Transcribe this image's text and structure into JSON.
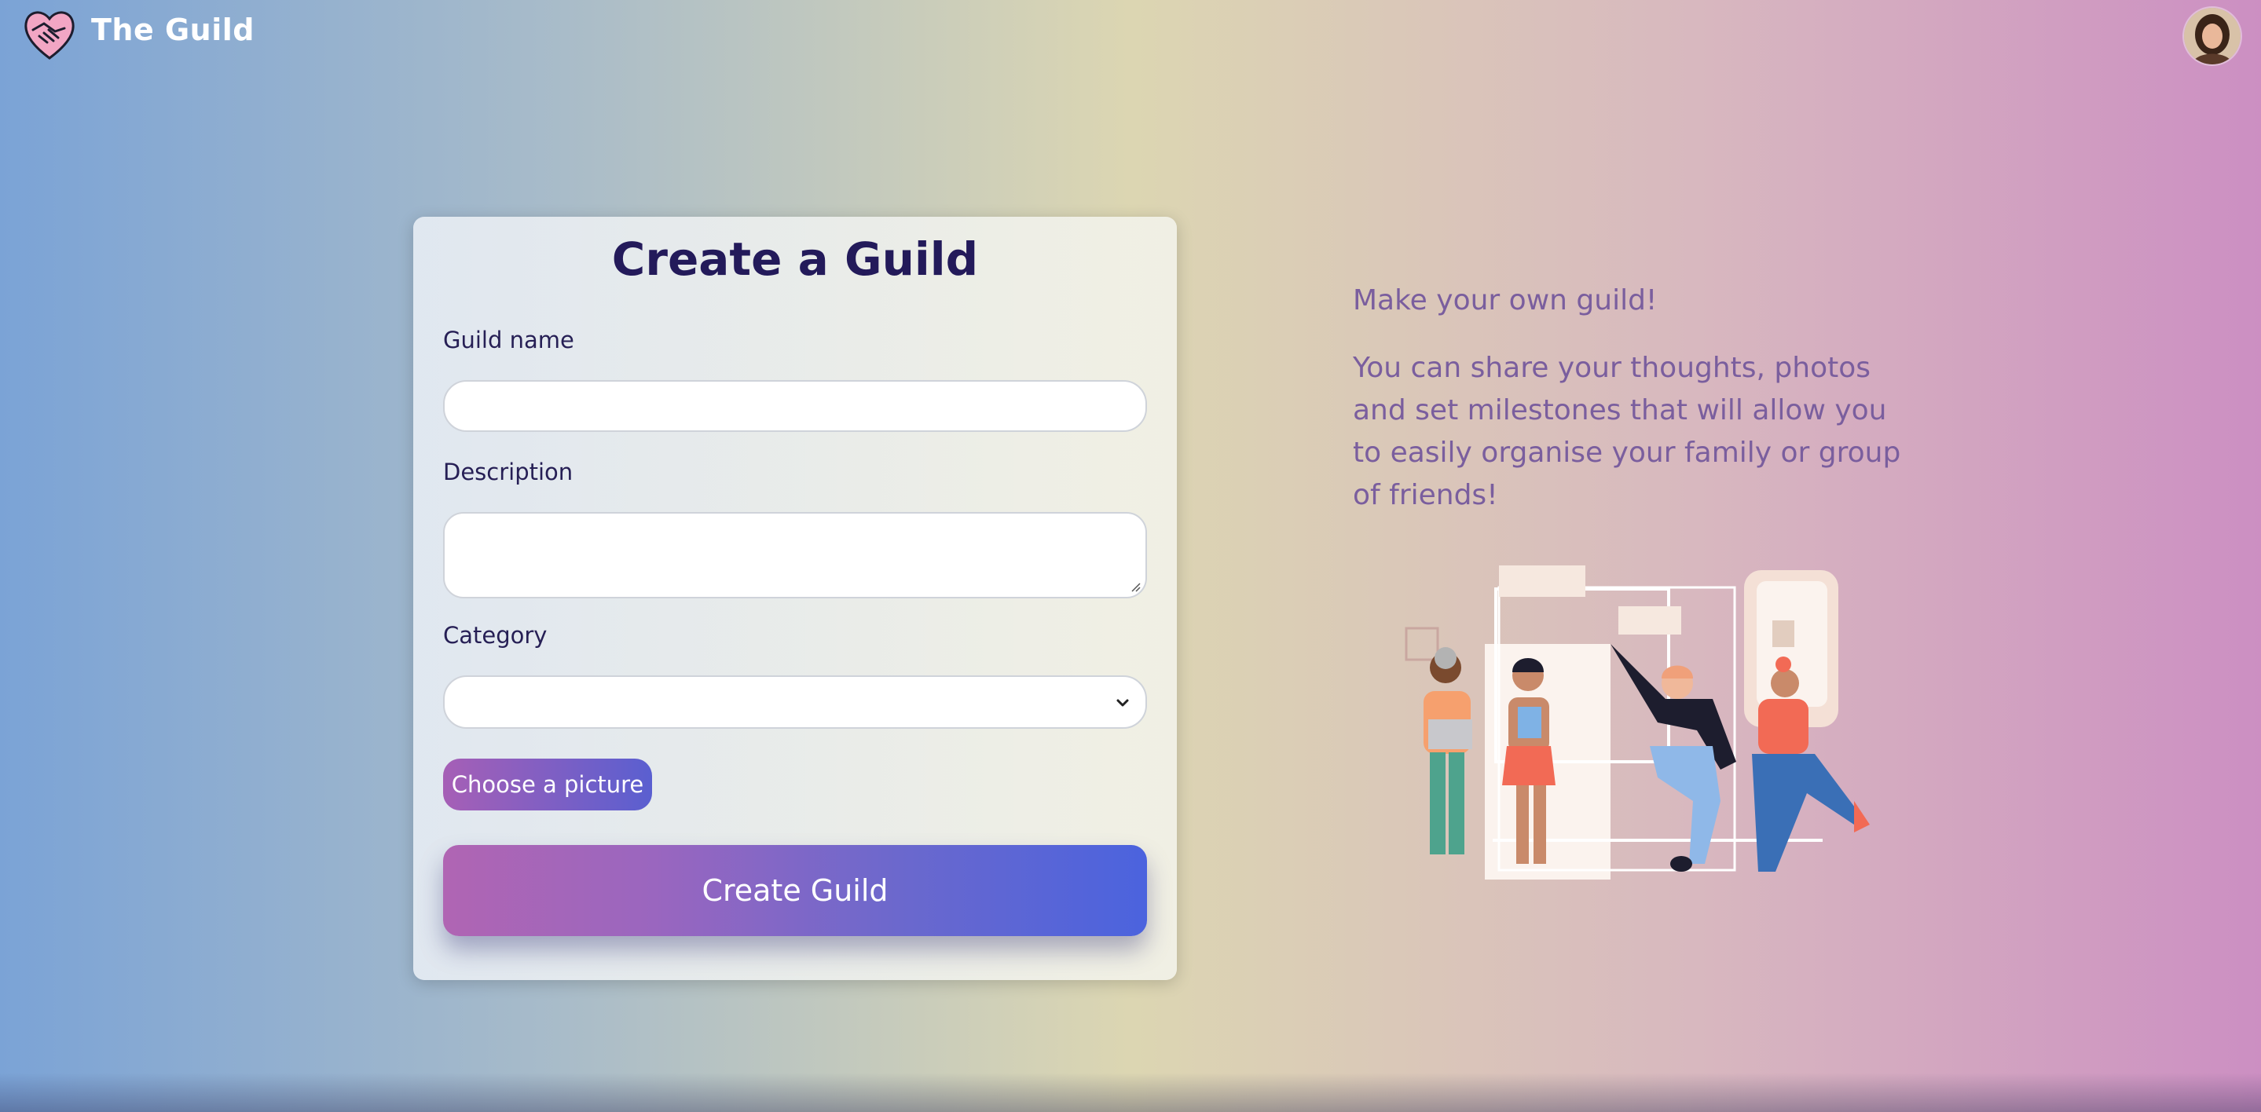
{
  "header": {
    "brand": "The Guild",
    "logo_icon": "handshake-heart-icon",
    "avatar_icon": "user-avatar"
  },
  "form": {
    "title": "Create a Guild",
    "guild_name_label": "Guild name",
    "guild_name_value": "",
    "description_label": "Description",
    "description_value": "",
    "category_label": "Category",
    "category_selected": "",
    "choose_picture_label": "Choose a picture",
    "submit_label": "Create Guild"
  },
  "info": {
    "tagline": "Make your own guild!",
    "description": "You can share your thoughts, photos and set milestones that will allow you to easily organise your family or group of friends!"
  },
  "colors": {
    "title": "#231a5a",
    "info_text": "#7a5e9e",
    "button_gradient_start": "#b065b3",
    "button_gradient_end": "#4b63de"
  }
}
